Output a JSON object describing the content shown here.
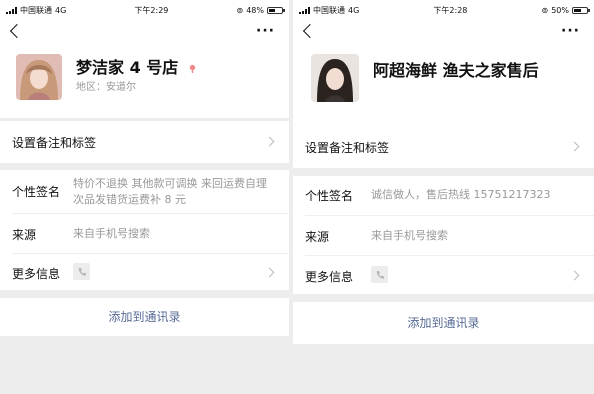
{
  "left": {
    "status": {
      "carrier": "中国联通",
      "network": "4G",
      "time": "下午2:29",
      "battery": "48%",
      "battery_level": 0.48
    },
    "profile": {
      "name": "梦洁家 4 号店",
      "region": "地区：安道尔",
      "avatar": "avatar-photo"
    },
    "set_remark": "设置备注和标签",
    "signature": {
      "label": "个性签名",
      "value": "特价不退换 其他款可调换 来回运费自理  次品发错货运费补 8 元"
    },
    "source": {
      "label": "来源",
      "value": "来自手机号搜索"
    },
    "more_info": {
      "label": "更多信息"
    },
    "add_contact": "添加到通讯录"
  },
  "right": {
    "status": {
      "carrier": "中国联通",
      "network": "4G",
      "time": "下午2:28",
      "battery": "50%",
      "battery_level": 0.5
    },
    "profile": {
      "name": "阿超海鲜 渔夫之家售后",
      "avatar": "avatar-photo"
    },
    "set_remark": "设置备注和标签",
    "signature": {
      "label": "个性签名",
      "value": "诚信做人，售后热线 15751217323"
    },
    "source": {
      "label": "来源",
      "value": "来自手机号搜索"
    },
    "more_info": {
      "label": "更多信息"
    },
    "add_contact": "添加到通讯录"
  },
  "colors": {
    "link": "#576b95",
    "background": "#ededed",
    "gender_icon": "#f08a8a"
  }
}
